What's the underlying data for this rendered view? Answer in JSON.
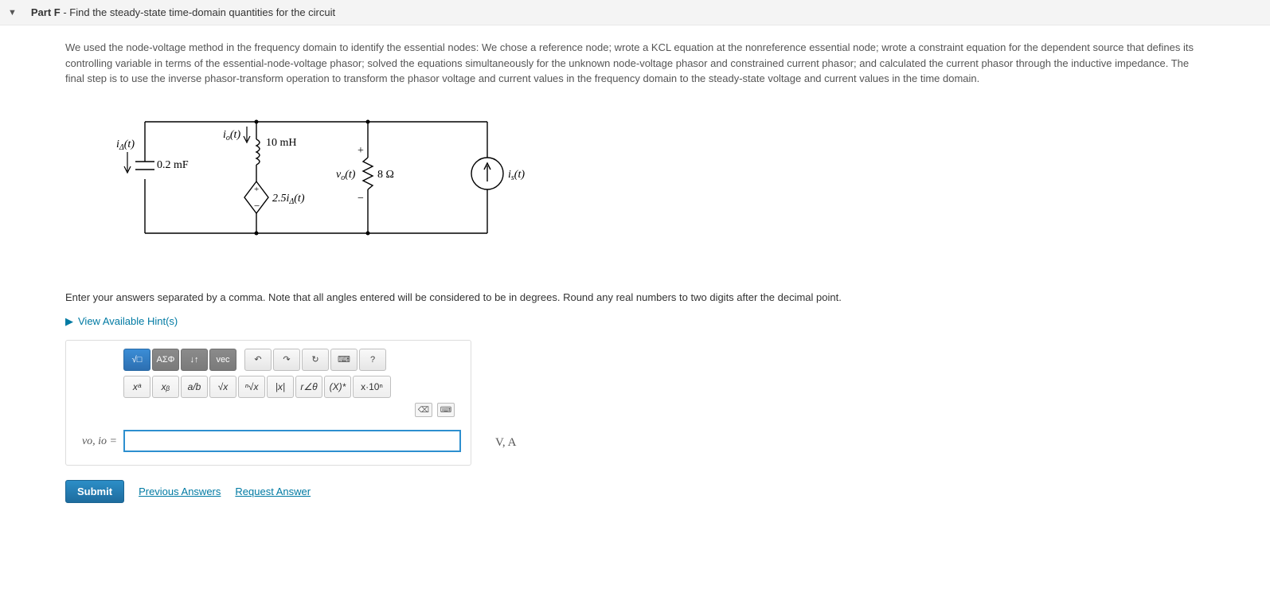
{
  "header": {
    "part_label": "Part F",
    "title": " - Find the steady-state time-domain quantities for the circuit"
  },
  "description": "We used the node-voltage method in the frequency domain to identify the essential nodes: We chose a reference node; wrote a KCL equation at the nonreference essential node; wrote a constraint equation for the dependent source that defines its controlling variable in terms of the essential-node-voltage phasor; solved the equations simultaneously for the unknown node-voltage phasor and constrained current phasor; and calculated the current phasor through the inductive impedance. The final step is to use the inverse phasor-transform operation to transform the phasor voltage and current values in the frequency domain to the steady-state voltage and current values in the time domain.",
  "circuit": {
    "i_delta": "iΔ(t)",
    "cap": "0.2 mF",
    "i_o": "io(t)",
    "ind": "10 mH",
    "dep_src": "2.5iΔ(t)",
    "v_o": "vo(t)",
    "res": "8 Ω",
    "plus": "+",
    "minus": "−",
    "i_s": "is(t)"
  },
  "instruction": "Enter your answers separated by a comma. Note that all angles entered will be considered to be in degrees. Round any real numbers to two digits after the decimal point.",
  "hints_label": "View Available Hint(s)",
  "toolbar": {
    "templates": "√□",
    "greek": "ΑΣΦ",
    "arrows": "↓↑",
    "vec": "vec",
    "undo": "↶",
    "redo": "↷",
    "reset": "↻",
    "keyboard": "⌨",
    "help": "?"
  },
  "subtoolbar": {
    "sup": "xᵃ",
    "sub": "xᵦ",
    "frac": "a/b",
    "sqr": "√x",
    "nroot": "ⁿ√x",
    "abs": "|x|",
    "phasor": "r∠θ",
    "conj": "(X)*",
    "sci": "x·10ⁿ"
  },
  "mini": {
    "bksp": "⌫",
    "kb": "⌨"
  },
  "answer": {
    "label": "vo, io =",
    "value": "",
    "units": "V, A"
  },
  "actions": {
    "submit": "Submit",
    "prev": "Previous Answers",
    "req": "Request Answer"
  }
}
